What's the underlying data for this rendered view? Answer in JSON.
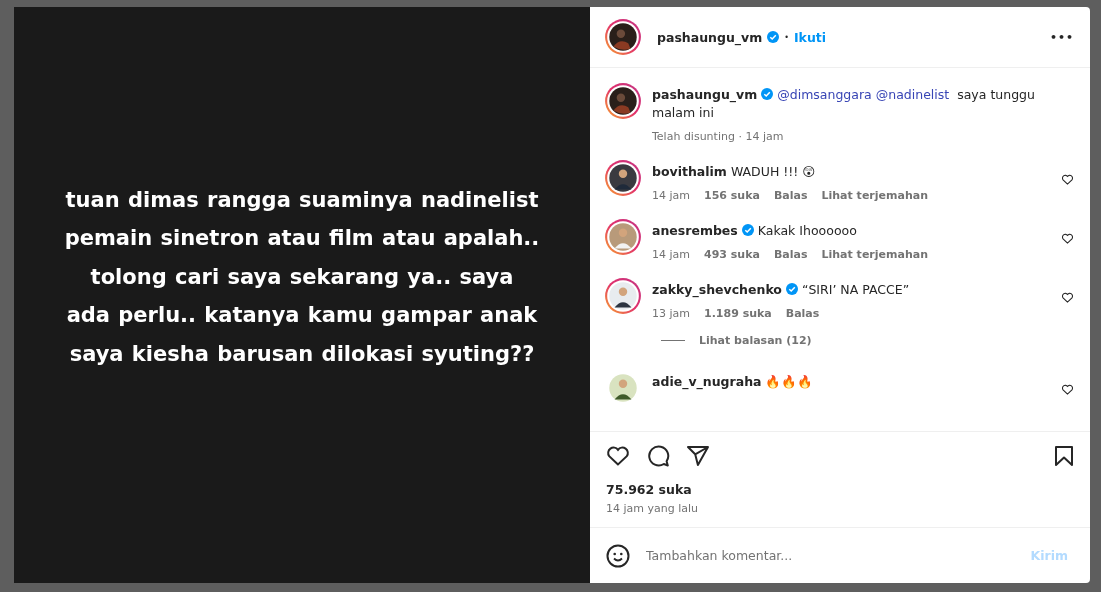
{
  "post_text": [
    "tuan dimas rangga suaminya nadinelist",
    "pemain sinetron atau film atau apalah..",
    "tolong cari saya sekarang ya.. saya",
    "ada perlu.. katanya kamu gampar anak",
    "saya kiesha barusan dilokasi syuting??"
  ],
  "header": {
    "username": "pashaungu_vm",
    "verified": true,
    "separator": "•",
    "follow": "Ikuti",
    "more": "•••"
  },
  "caption": {
    "username": "pashaungu_vm",
    "verified": true,
    "mentions": [
      "@dimsanggara",
      "@nadinelist"
    ],
    "text": "saya tunggu malam ini",
    "meta": "Telah disunting · 14 jam"
  },
  "comments": [
    {
      "username": "bovithalim",
      "verified": false,
      "text": "WADUH !!! 😲",
      "time": "14 jam",
      "likes": "156 suka",
      "reply": "Balas",
      "translate": "Lihat terjemahan",
      "liked": false
    },
    {
      "username": "anesrembes",
      "verified": true,
      "text": "Kakak Ihoooooo",
      "time": "14 jam",
      "likes": "493 suka",
      "reply": "Balas",
      "translate": "Lihat terjemahan",
      "liked": false
    },
    {
      "username": "zakky_shevchenko",
      "verified": true,
      "text": "“SIRI’ NA PACCE”",
      "time": "13 jam",
      "likes": "1.189 suka",
      "reply": "Balas",
      "view_replies": "Lihat balasan (12)",
      "liked": false
    },
    {
      "username": "adie_v_nugraha",
      "verified": false,
      "text": "🔥🔥🔥",
      "liked": false
    }
  ],
  "actions": {
    "liked": false,
    "saved": false
  },
  "likes": "75.962 suka",
  "posted": "14 jam yang lalu",
  "comment_box": {
    "placeholder": "Tambahkan komentar...",
    "send": "Kirim"
  }
}
